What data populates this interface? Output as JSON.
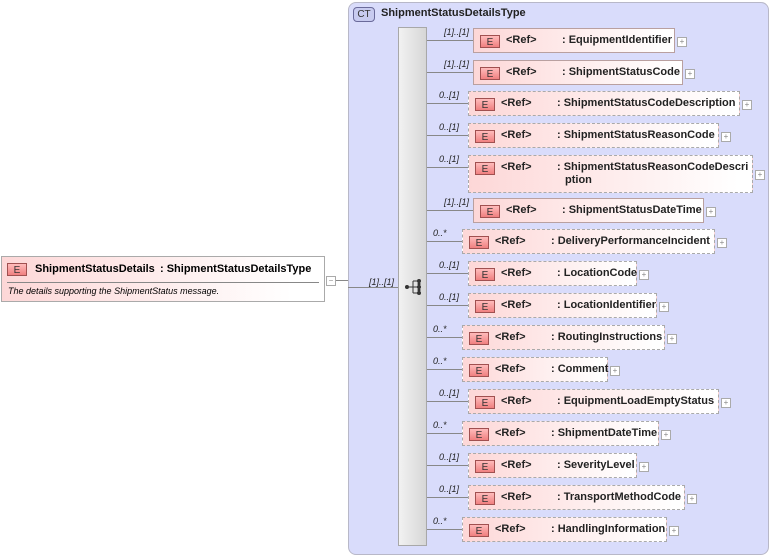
{
  "main_element": {
    "badge": "E",
    "name": "ShipmentStatusDetails",
    "type": ": ShipmentStatusDetailsType",
    "description": "The details supporting the ShipmentStatus message.",
    "cardinality": "[1]..[1]",
    "collapse": "−"
  },
  "complex_type": {
    "badge": "CT",
    "name": "ShipmentStatusDetailsType"
  },
  "children": [
    {
      "card": "[1]..[1]",
      "ref": "<Ref>",
      "name": ": EquipmentIdentifier"
    },
    {
      "card": "[1]..[1]",
      "ref": "<Ref>",
      "name": ": ShipmentStatusCode"
    },
    {
      "card": "0..[1]",
      "ref": "<Ref>",
      "name": ": ShipmentStatusCodeDescription"
    },
    {
      "card": "0..[1]",
      "ref": "<Ref>",
      "name": ": ShipmentStatusReasonCode"
    },
    {
      "card": "0..[1]",
      "ref": "<Ref>",
      "name": ": ShipmentStatusReasonCodeDescri",
      "name2": "ption"
    },
    {
      "card": "[1]..[1]",
      "ref": "<Ref>",
      "name": ": ShipmentStatusDateTime"
    },
    {
      "card": "0..*",
      "ref": "<Ref>",
      "name": ": DeliveryPerformanceIncident"
    },
    {
      "card": "0..[1]",
      "ref": "<Ref>",
      "name": ": LocationCode"
    },
    {
      "card": "0..[1]",
      "ref": "<Ref>",
      "name": ": LocationIdentifier"
    },
    {
      "card": "0..*",
      "ref": "<Ref>",
      "name": ": RoutingInstructions"
    },
    {
      "card": "0..*",
      "ref": "<Ref>",
      "name": ": Comment"
    },
    {
      "card": "0..[1]",
      "ref": "<Ref>",
      "name": ": EquipmentLoadEmptyStatus"
    },
    {
      "card": "0..*",
      "ref": "<Ref>",
      "name": ": ShipmentDateTime"
    },
    {
      "card": "0..[1]",
      "ref": "<Ref>",
      "name": ": SeverityLevel"
    },
    {
      "card": "0..[1]",
      "ref": "<Ref>",
      "name": ": TransportMethodCode"
    },
    {
      "card": "0..*",
      "ref": "<Ref>",
      "name": ": HandlingInformation"
    }
  ],
  "badge_e": "E",
  "expand": "+"
}
